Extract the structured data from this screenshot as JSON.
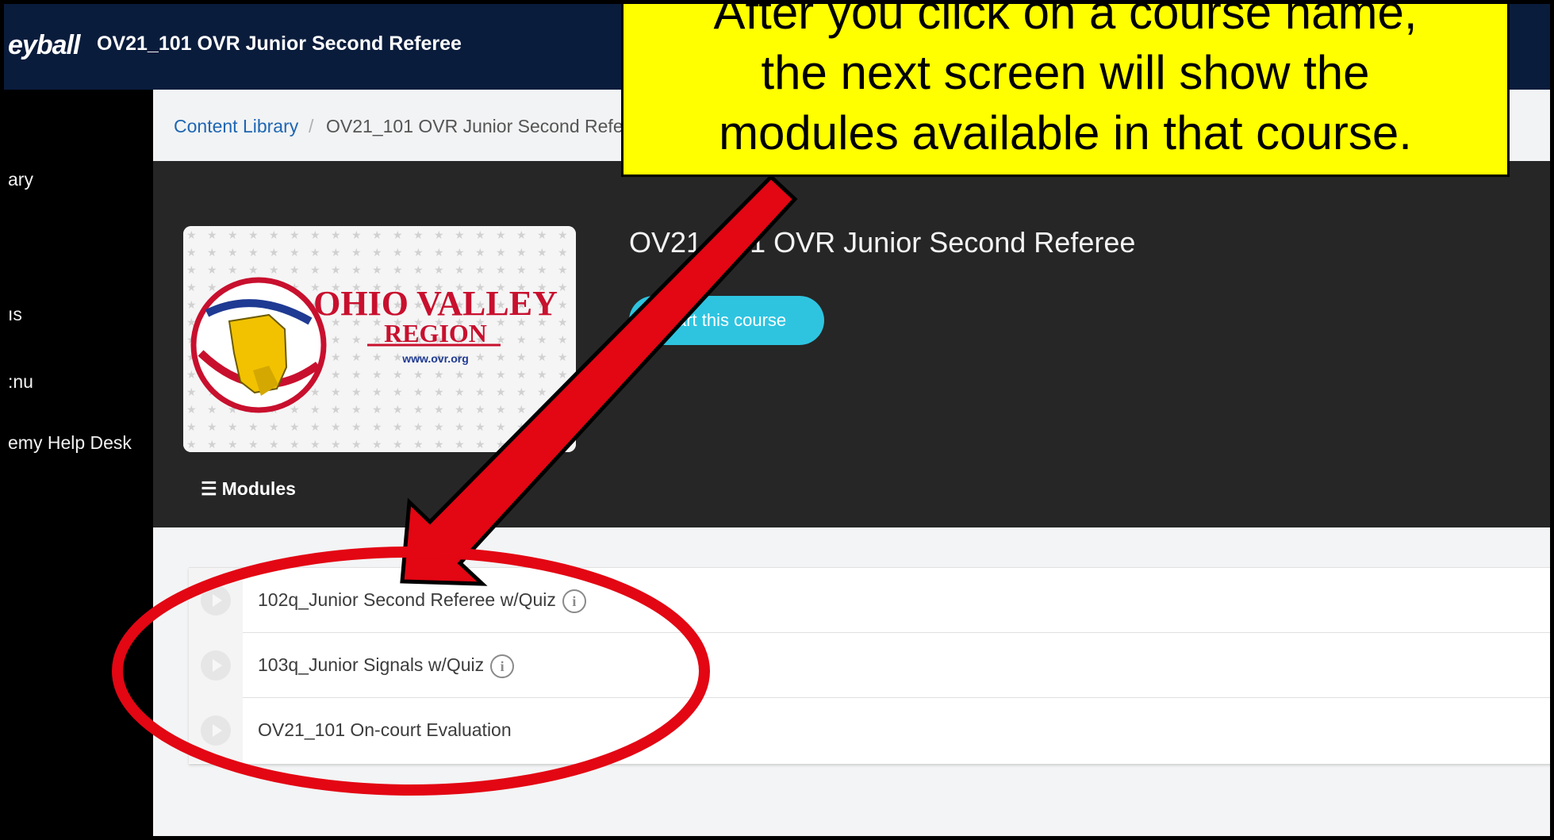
{
  "topbar": {
    "brand": "eyball",
    "course_title": "OV21_101 OVR Junior Second Referee"
  },
  "sidebar": {
    "items": [
      {
        "label": "ary"
      },
      {
        "label": "ıs"
      },
      {
        "label": ":nu"
      },
      {
        "label": "emy Help Desk"
      }
    ]
  },
  "breadcrumb": {
    "root": "Content Library",
    "separator": "/",
    "current": "OV21_101 OVR Junior Second Refe"
  },
  "course": {
    "title": "OV21_101 OVR Junior Second Referee",
    "start_button": "art this course",
    "logo": {
      "name_line1": "OHIO VALLEY",
      "name_line2": "REGION",
      "url": "www.ovr.org"
    },
    "modules_tab": "Modules"
  },
  "modules": [
    {
      "title": "102q_Junior Second Referee w/Quiz",
      "has_info": true
    },
    {
      "title": "103q_Junior Signals w/Quiz",
      "has_info": true
    },
    {
      "title": "OV21_101 On-court Evaluation",
      "has_info": false
    }
  ],
  "annotation": {
    "line1": "After you click on a course name,",
    "line2": "the next screen will show the",
    "line3": "modules available in that course."
  },
  "colors": {
    "topbar": "#0a1c3c",
    "accent_button": "#2ec4e0",
    "callout": "#ffff00",
    "arrow": "#e30613"
  }
}
